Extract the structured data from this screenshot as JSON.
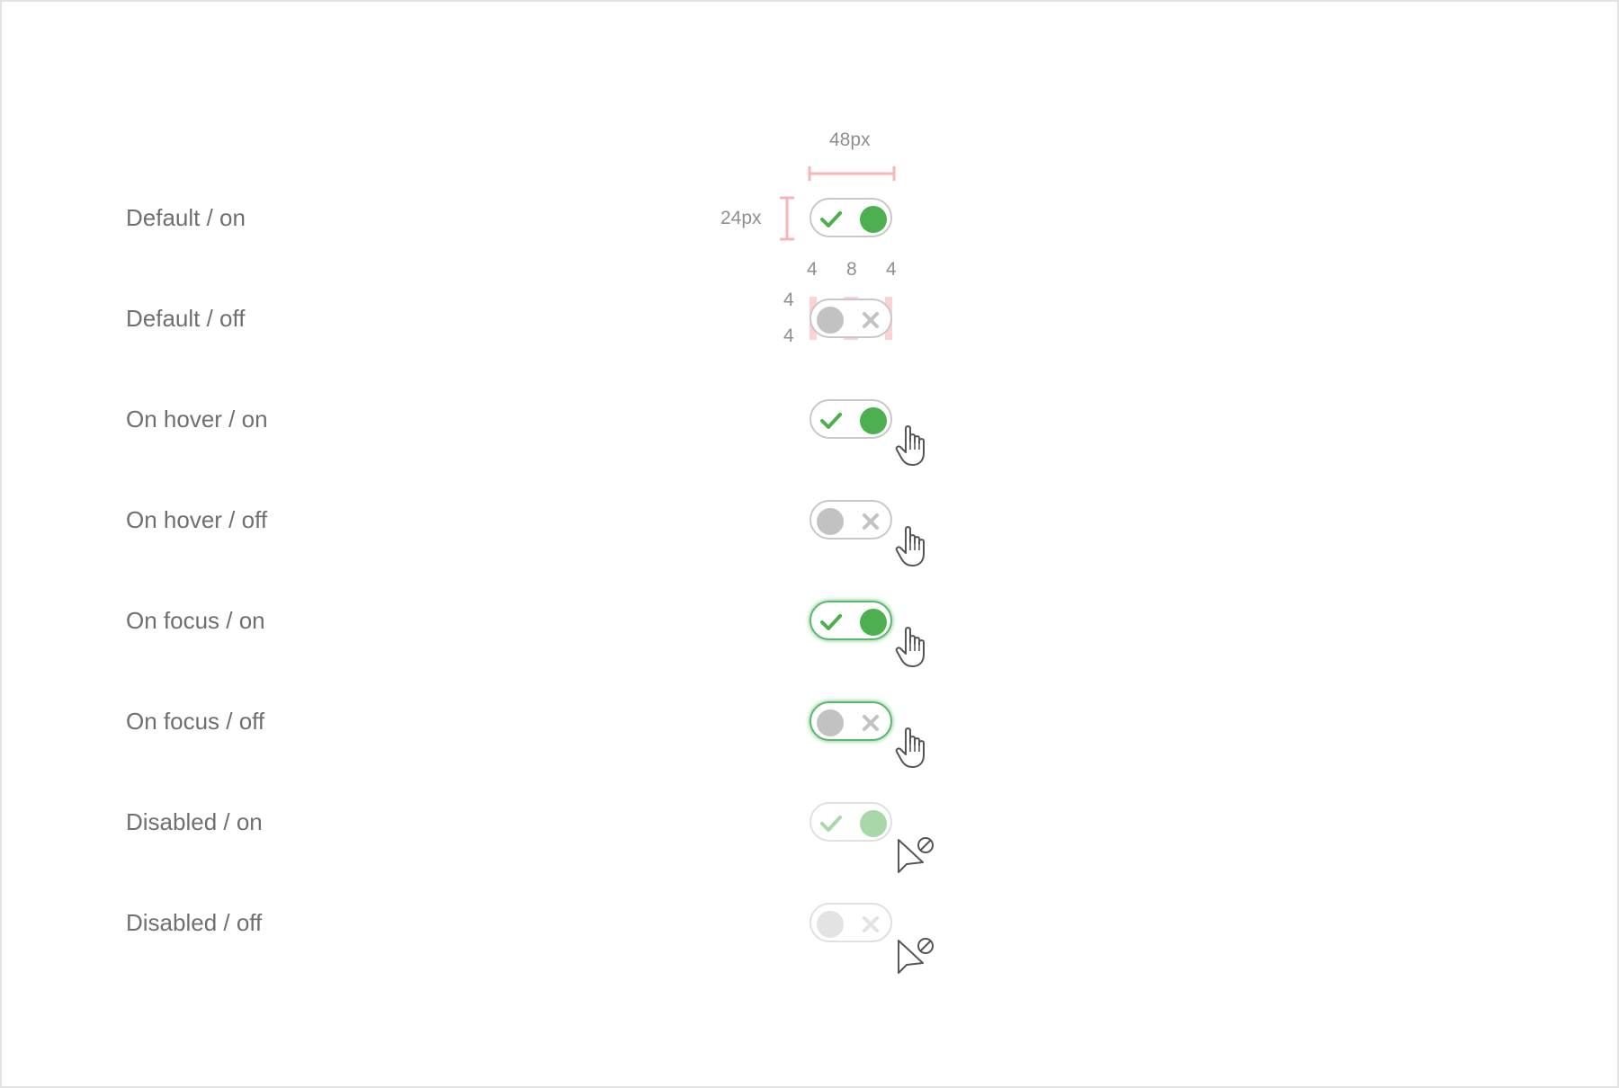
{
  "colors": {
    "accent": "#4caf50",
    "knob_off": "#c2c2c2",
    "disabled_on": "#a8d8aa",
    "disabled_off": "#e3e3e3",
    "measure": "#f4b6b6",
    "label_text": "#6f6f6f"
  },
  "dimensions": {
    "width_label": "48px",
    "height_label": "24px",
    "spacing_horizontal": [
      "4",
      "8",
      "4"
    ],
    "spacing_vertical": [
      "4",
      "4"
    ]
  },
  "states": [
    {
      "label": "Default / on",
      "checked": true,
      "state": "default",
      "cursor": "none"
    },
    {
      "label": "Default / off",
      "checked": false,
      "state": "default",
      "cursor": "none"
    },
    {
      "label": "On hover / on",
      "checked": true,
      "state": "hover",
      "cursor": "hand-pointer-icon"
    },
    {
      "label": "On hover / off",
      "checked": false,
      "state": "hover",
      "cursor": "hand-pointer-icon"
    },
    {
      "label": "On focus / on",
      "checked": true,
      "state": "focus",
      "cursor": "hand-pointer-icon"
    },
    {
      "label": "On focus / off",
      "checked": false,
      "state": "focus",
      "cursor": "hand-pointer-icon"
    },
    {
      "label": "Disabled / on",
      "checked": true,
      "state": "disabled",
      "cursor": "not-allowed-icon"
    },
    {
      "label": "Disabled / off",
      "checked": false,
      "state": "disabled",
      "cursor": "not-allowed-icon"
    }
  ]
}
